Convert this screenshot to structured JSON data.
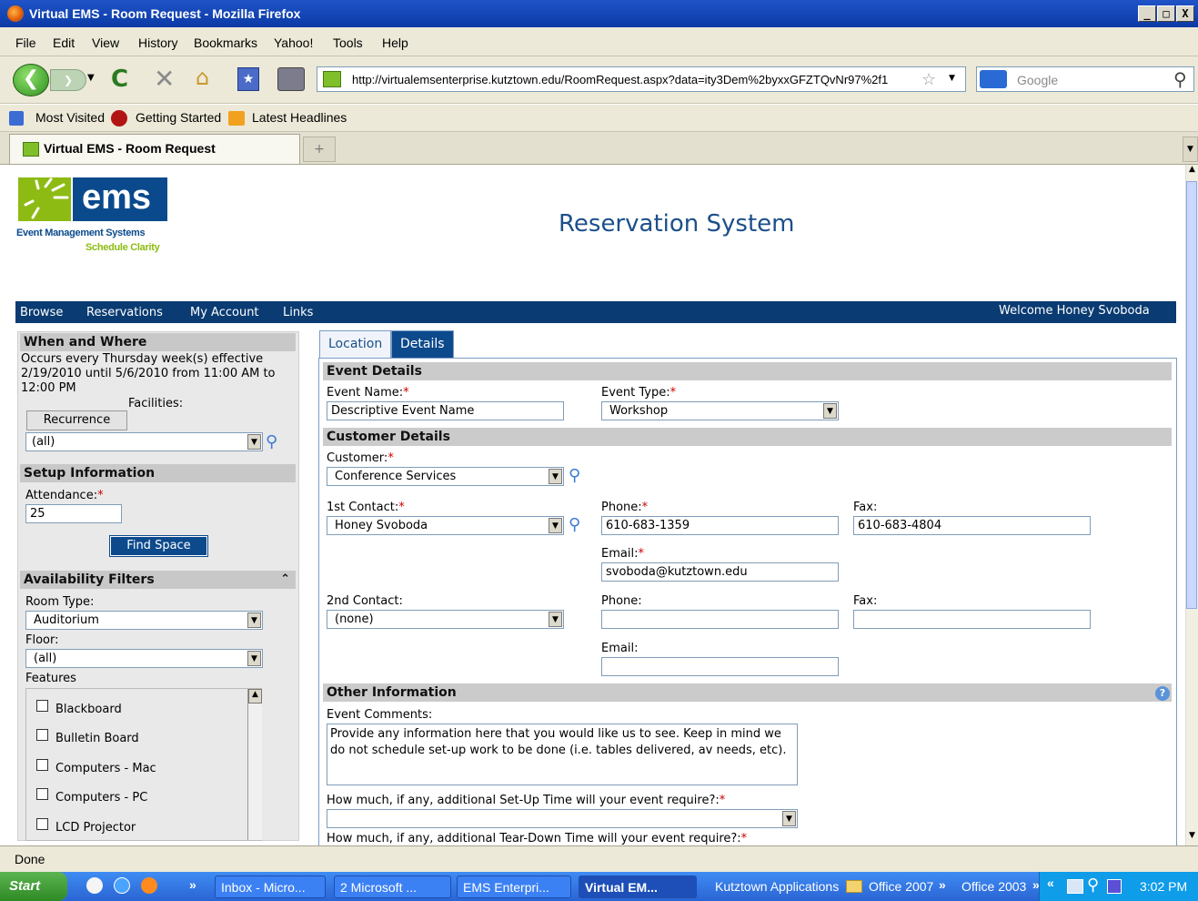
{
  "window": {
    "title": "Virtual EMS - Room Request - Mozilla Firefox",
    "buttons": [
      "_",
      "□",
      "X"
    ]
  },
  "menu": {
    "items": [
      "File",
      "Edit",
      "View",
      "History",
      "Bookmarks",
      "Yahoo!",
      "Tools",
      "Help"
    ]
  },
  "nav": {
    "url": "http://virtualemsenterprise.kutztown.edu/RoomRequest.aspx?data=ity3Dem%2byxxGFZTQvNr97%2f1",
    "search_placeholder": "Google"
  },
  "bookmarks": {
    "items": [
      "Most Visited",
      "Getting Started",
      "Latest Headlines"
    ]
  },
  "tabs": {
    "active": "Virtual EMS - Room Request",
    "new_tab": "+"
  },
  "page": {
    "logo": {
      "wordmark": "ems",
      "line1": "Event Management Systems",
      "line2": "Schedule Clarity"
    },
    "heading": "Reservation System",
    "nav": {
      "links": [
        "Browse",
        "Reservations",
        "My Account",
        "Links"
      ],
      "welcome": "Welcome Honey Svoboda"
    },
    "when_where": {
      "header": "When and Where",
      "description": "Occurs every Thursday week(s) effective 2/19/2010 until 5/6/2010 from 11:00 AM to 12:00 PM",
      "facilities_label": "Facilities:",
      "recurrence_button": "Recurrence",
      "facility_value": "(all)"
    },
    "setup": {
      "header": "Setup Information",
      "attendance_label": "Attendance:",
      "attendance_value": "25",
      "find_space_button": "Find Space"
    },
    "filters": {
      "header": "Availability Filters",
      "collapse_symbol": "⌃",
      "room_type_label": "Room Type:",
      "room_type_value": "Auditorium",
      "floor_label": "Floor:",
      "floor_value": "(all)",
      "features_label": "Features",
      "features": [
        "Blackboard",
        "Bulletin Board",
        "Computers - Mac",
        "Computers - PC",
        "LCD Projector"
      ]
    },
    "form_tabs": [
      "Location",
      "Details"
    ],
    "event_details": {
      "header": "Event Details",
      "name_label": "Event Name:",
      "name_value": "Descriptive Event Name",
      "type_label": "Event Type:",
      "type_value": "Workshop"
    },
    "customer_details": {
      "header": "Customer Details",
      "customer_label": "Customer:",
      "customer_value": "Conference Services",
      "contact1_label": "1st Contact:",
      "contact1_value": "Honey Svoboda",
      "phone1_label": "Phone:",
      "phone1_value": "610-683-1359",
      "fax1_label": "Fax:",
      "fax1_value": "610-683-4804",
      "email1_label": "Email:",
      "email1_value": "svoboda@kutztown.edu",
      "contact2_label": "2nd Contact:",
      "contact2_value": "(none)",
      "phone2_label": "Phone:",
      "fax2_label": "Fax:",
      "email2_label": "Email:"
    },
    "other": {
      "header": "Other Information",
      "help_symbol": "?",
      "comments_label": "Event Comments:",
      "comments_value": "Provide any information here that you would like us to see.  Keep in mind we do not schedule set-up work to be done (i.e. tables delivered, av needs, etc).",
      "setup_time_label": "How much, if any, additional Set-Up Time will your event require?:",
      "teardown_time_label": "How much, if any, additional Tear-Down Time will your event require?:"
    },
    "required_marker": "*"
  },
  "status": {
    "text": "Done"
  },
  "taskbar": {
    "start": "Start",
    "chevron": "»",
    "items": [
      "Inbox - Micro...",
      "2 Microsoft ...",
      "EMS Enterpri...",
      "Virtual EM..."
    ],
    "toolbars": [
      "Kutztown Applications",
      "Office 2007",
      "Office 2003"
    ],
    "clock": "3:02 PM"
  }
}
